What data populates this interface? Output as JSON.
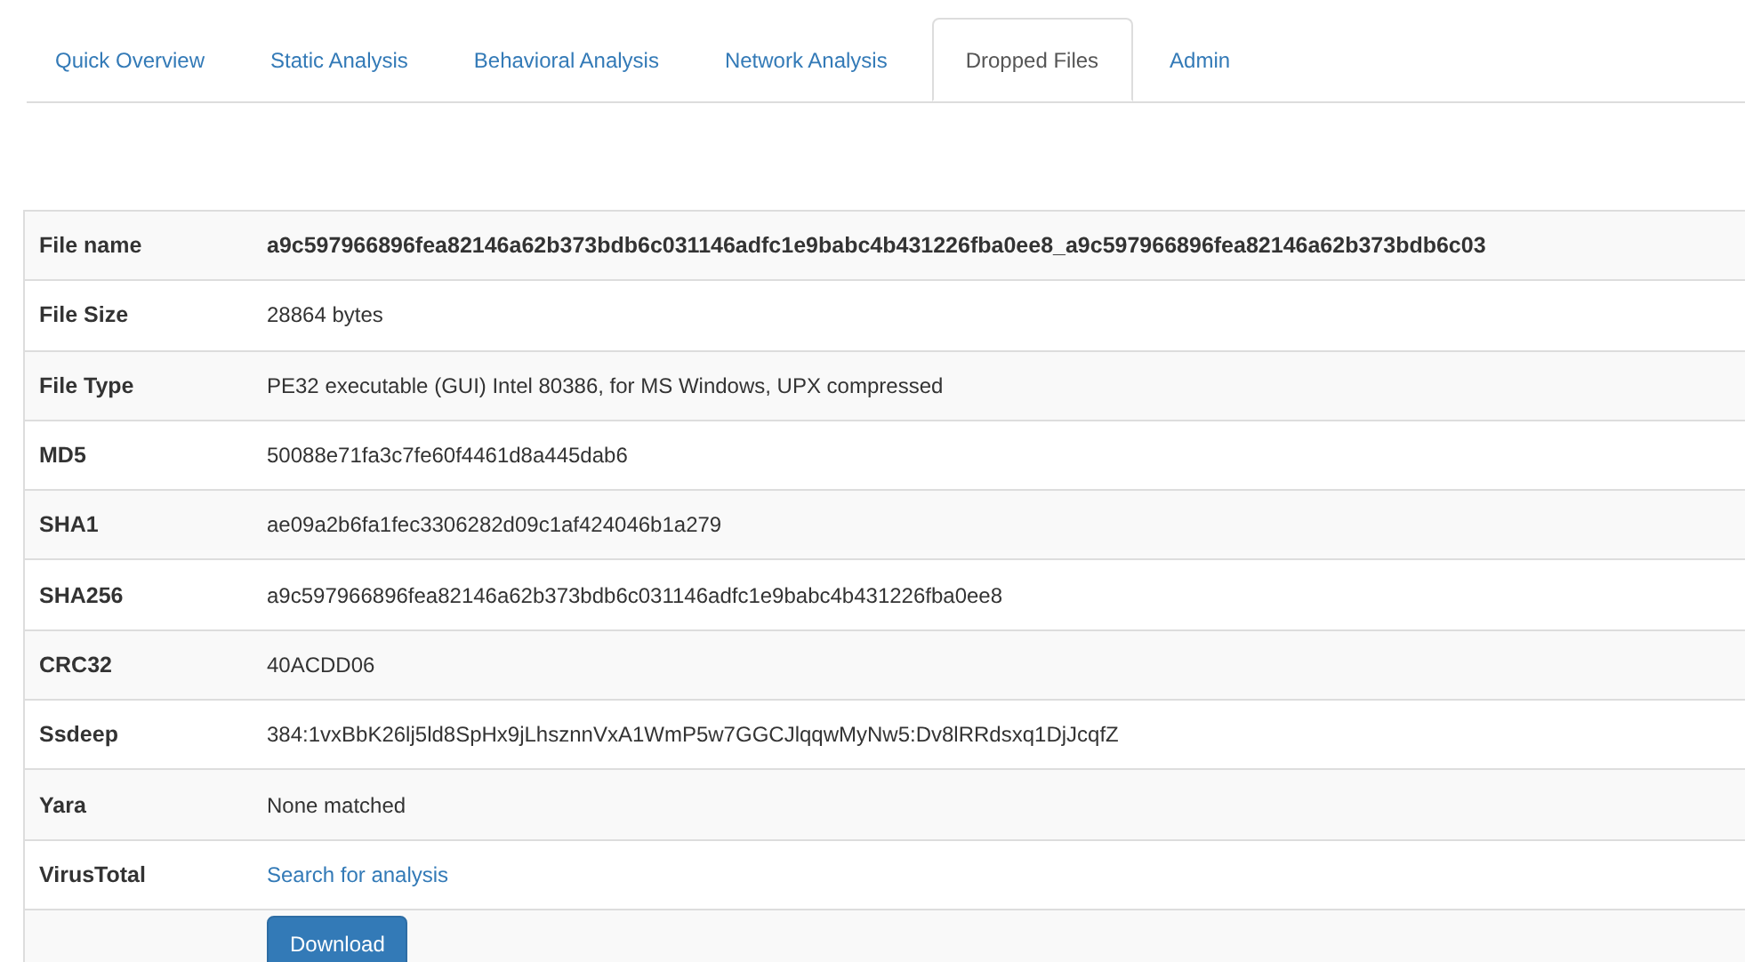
{
  "tabs": [
    {
      "label": "Quick Overview",
      "selected": false
    },
    {
      "label": "Static Analysis",
      "selected": false
    },
    {
      "label": "Behavioral Analysis",
      "selected": false
    },
    {
      "label": "Network Analysis",
      "selected": false
    },
    {
      "label": "Dropped Files",
      "selected": true
    },
    {
      "label": "Admin",
      "selected": false
    }
  ],
  "file_table": {
    "rows": [
      {
        "label": "File name",
        "value": "a9c597966896fea82146a62b373bdb6c031146adfc1e9babc4b431226fba0ee8_a9c597966896fea82146a62b373bdb6c03",
        "kind": "bold"
      },
      {
        "label": "File Size",
        "value": "28864 bytes",
        "kind": "text"
      },
      {
        "label": "File Type",
        "value": "PE32 executable (GUI) Intel 80386, for MS Windows, UPX compressed",
        "kind": "text"
      },
      {
        "label": "MD5",
        "value": "50088e71fa3c7fe60f4461d8a445dab6",
        "kind": "text"
      },
      {
        "label": "SHA1",
        "value": "ae09a2b6fa1fec3306282d09c1af424046b1a279",
        "kind": "text"
      },
      {
        "label": "SHA256",
        "value": "a9c597966896fea82146a62b373bdb6c031146adfc1e9babc4b431226fba0ee8",
        "kind": "text"
      },
      {
        "label": "CRC32",
        "value": "40ACDD06",
        "kind": "text"
      },
      {
        "label": "Ssdeep",
        "value": "384:1vxBbK26lj5ld8SpHx9jLhsznnVxA1WmP5w7GGCJlqqwMyNw5:Dv8lRRdsxq1DjJcqfZ",
        "kind": "text"
      },
      {
        "label": "Yara",
        "value": "None matched",
        "kind": "text"
      },
      {
        "label": "VirusTotal",
        "value": "Search for analysis",
        "kind": "link"
      },
      {
        "value": "Download",
        "kind": "button"
      }
    ]
  }
}
